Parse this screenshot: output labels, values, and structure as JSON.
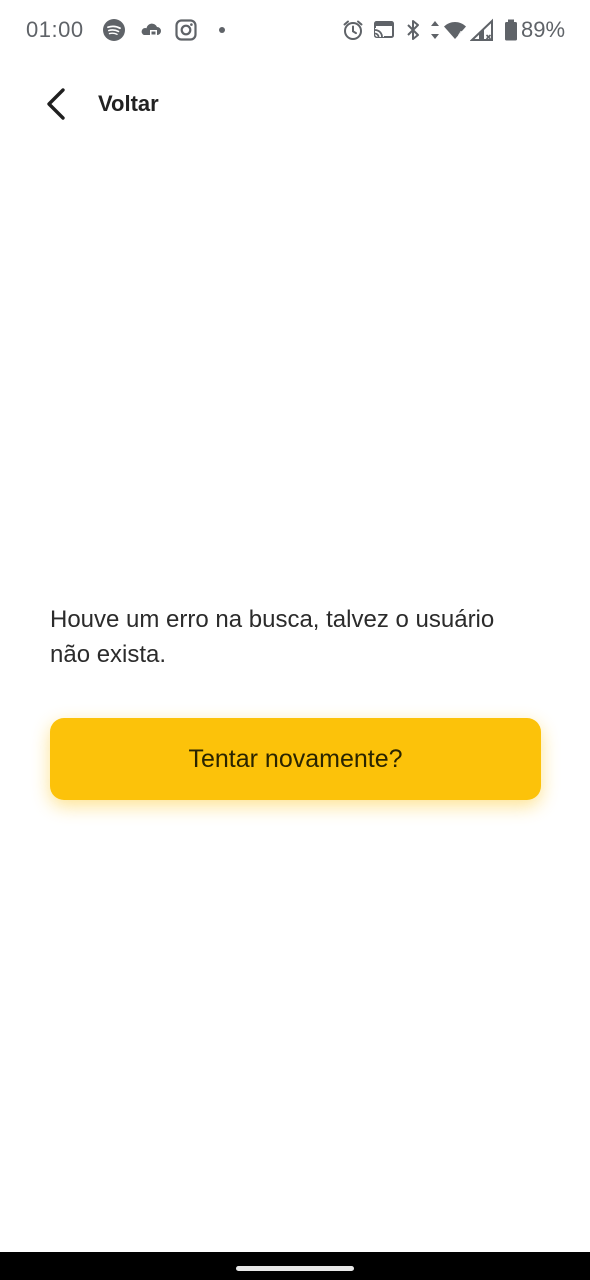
{
  "status_bar": {
    "time": "01:00",
    "battery_percent": "89%",
    "left_icons": [
      "spotify-icon",
      "cloud-icon",
      "instagram-icon",
      "dot-icon"
    ],
    "right_icons": [
      "alarm-icon",
      "cast-icon",
      "bluetooth-icon",
      "data-arrows-icon",
      "wifi-icon",
      "signal-icon",
      "battery-icon"
    ],
    "battery_level": 0.89
  },
  "header": {
    "back_label": "Voltar",
    "back_icon": "chevron-left-icon"
  },
  "main": {
    "error_message": "Houve um erro na busca, talvez o usuário não exista.",
    "retry_label": "Tentar novamente?"
  },
  "colors": {
    "accent": "#fcc20a",
    "text": "#222222",
    "status_icons": "#5f6368",
    "background": "#ffffff",
    "nav_bar": "#000000"
  }
}
